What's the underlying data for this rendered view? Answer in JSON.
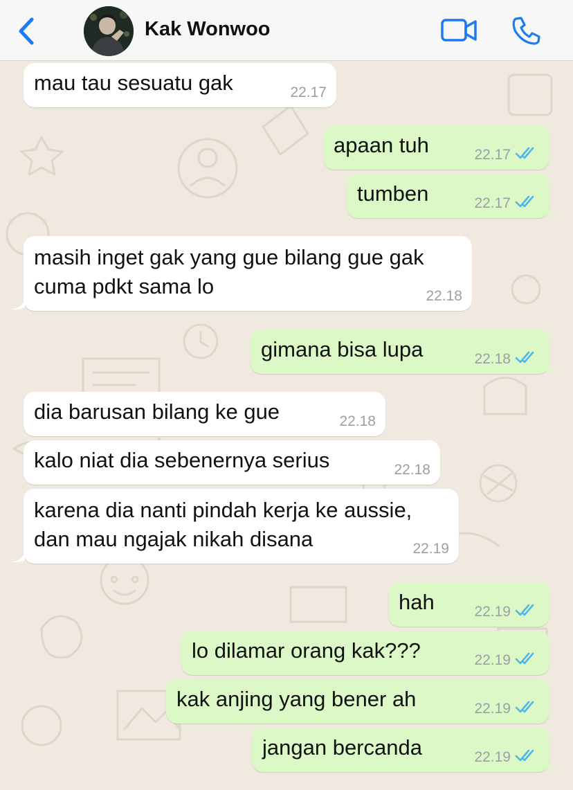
{
  "header": {
    "contact_name": "Kak Wonwoo",
    "accent_color": "#1a7bf2",
    "back_icon": "chevron-left-icon",
    "video_icon": "video-camera-icon",
    "call_icon": "phone-icon"
  },
  "colors": {
    "incoming_bubble": "#ffffff",
    "outgoing_bubble": "#dcf8c6",
    "read_ticks": "#4fb6ec",
    "wallpaper": "#efe9df"
  },
  "messages": [
    {
      "direction": "in",
      "text": "mau tau sesuatu gak",
      "time": "22.17"
    },
    {
      "direction": "out",
      "text": "apaan tuh",
      "time": "22.17",
      "status": "read"
    },
    {
      "direction": "out",
      "text": "tumben",
      "time": "22.17",
      "status": "read"
    },
    {
      "direction": "in",
      "text": "masih inget gak yang gue bilang gue gak\ncuma pdkt sama lo",
      "time": "22.18"
    },
    {
      "direction": "out",
      "text": "gimana bisa lupa",
      "time": "22.18",
      "status": "read"
    },
    {
      "direction": "in",
      "text": "dia barusan bilang ke gue",
      "time": "22.18"
    },
    {
      "direction": "in",
      "text": "kalo niat dia sebenernya serius",
      "time": "22.18"
    },
    {
      "direction": "in",
      "text": "karena dia nanti pindah kerja ke aussie,\ndan mau ngajak nikah disana",
      "time": "22.19"
    },
    {
      "direction": "out",
      "text": "hah",
      "time": "22.19",
      "status": "read"
    },
    {
      "direction": "out",
      "text": "lo dilamar orang kak???",
      "time": "22.19",
      "status": "read"
    },
    {
      "direction": "out",
      "text": "kak anjing yang bener ah",
      "time": "22.19",
      "status": "read"
    },
    {
      "direction": "out",
      "text": "jangan bercanda",
      "time": "22.19",
      "status": "read"
    }
  ]
}
